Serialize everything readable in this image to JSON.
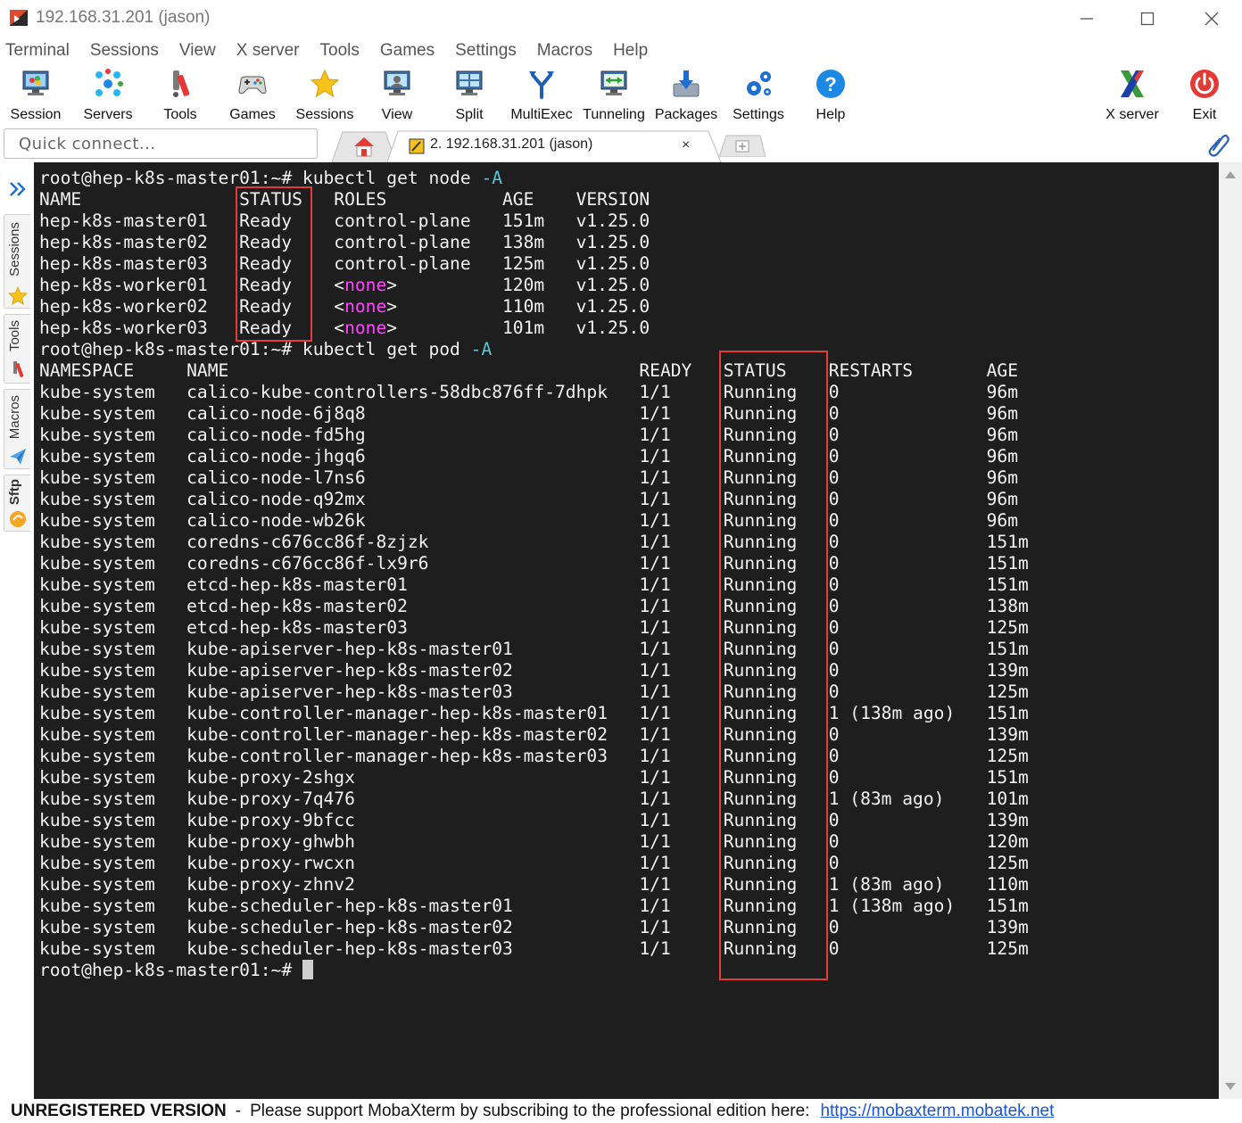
{
  "window": {
    "title": "192.168.31.201 (jason)"
  },
  "menu": [
    "Terminal",
    "Sessions",
    "View",
    "X server",
    "Tools",
    "Games",
    "Settings",
    "Macros",
    "Help"
  ],
  "toolbar": {
    "session": "Session",
    "servers": "Servers",
    "tools": "Tools",
    "games": "Games",
    "sessions": "Sessions",
    "view": "View",
    "split": "Split",
    "multiexec": "MultiExec",
    "tunneling": "Tunneling",
    "packages": "Packages",
    "settings": "Settings",
    "help": "Help",
    "xserver": "X server",
    "exit": "Exit"
  },
  "quick_connect": {
    "placeholder": "Quick connect..."
  },
  "tabs": {
    "active_label": "2. 192.168.31.201 (jason)",
    "close_glyph": "×"
  },
  "side_tabs": {
    "sessions": "Sessions",
    "tools": "Tools",
    "macros": "Macros",
    "sftp": "Sftp"
  },
  "terminal": {
    "prompt": "root@hep-k8s-master01:~# ",
    "node_cmd": "kubectl get node",
    "flag": "-A",
    "pod_cmd": "kubectl get pod",
    "node_header": [
      "NAME",
      "STATUS",
      "ROLES",
      "AGE",
      "VERSION"
    ],
    "nodes": [
      {
        "name": "hep-k8s-master01",
        "status": "Ready",
        "roles": "control-plane",
        "age": "151m",
        "version": "v1.25.0"
      },
      {
        "name": "hep-k8s-master02",
        "status": "Ready",
        "roles": "control-plane",
        "age": "138m",
        "version": "v1.25.0"
      },
      {
        "name": "hep-k8s-master03",
        "status": "Ready",
        "roles": "control-plane",
        "age": "125m",
        "version": "v1.25.0"
      },
      {
        "name": "hep-k8s-worker01",
        "status": "Ready",
        "roles": "<none>",
        "age": "120m",
        "version": "v1.25.0"
      },
      {
        "name": "hep-k8s-worker02",
        "status": "Ready",
        "roles": "<none>",
        "age": "110m",
        "version": "v1.25.0"
      },
      {
        "name": "hep-k8s-worker03",
        "status": "Ready",
        "roles": "<none>",
        "age": "101m",
        "version": "v1.25.0"
      }
    ],
    "pod_header": [
      "NAMESPACE",
      "NAME",
      "READY",
      "STATUS",
      "RESTARTS",
      "AGE"
    ],
    "pods": [
      {
        "ns": "kube-system",
        "name": "calico-kube-controllers-58dbc876ff-7dhpk",
        "ready": "1/1",
        "status": "Running",
        "restarts": "0",
        "age": "96m"
      },
      {
        "ns": "kube-system",
        "name": "calico-node-6j8q8",
        "ready": "1/1",
        "status": "Running",
        "restarts": "0",
        "age": "96m"
      },
      {
        "ns": "kube-system",
        "name": "calico-node-fd5hg",
        "ready": "1/1",
        "status": "Running",
        "restarts": "0",
        "age": "96m"
      },
      {
        "ns": "kube-system",
        "name": "calico-node-jhgq6",
        "ready": "1/1",
        "status": "Running",
        "restarts": "0",
        "age": "96m"
      },
      {
        "ns": "kube-system",
        "name": "calico-node-l7ns6",
        "ready": "1/1",
        "status": "Running",
        "restarts": "0",
        "age": "96m"
      },
      {
        "ns": "kube-system",
        "name": "calico-node-q92mx",
        "ready": "1/1",
        "status": "Running",
        "restarts": "0",
        "age": "96m"
      },
      {
        "ns": "kube-system",
        "name": "calico-node-wb26k",
        "ready": "1/1",
        "status": "Running",
        "restarts": "0",
        "age": "96m"
      },
      {
        "ns": "kube-system",
        "name": "coredns-c676cc86f-8zjzk",
        "ready": "1/1",
        "status": "Running",
        "restarts": "0",
        "age": "151m"
      },
      {
        "ns": "kube-system",
        "name": "coredns-c676cc86f-lx9r6",
        "ready": "1/1",
        "status": "Running",
        "restarts": "0",
        "age": "151m"
      },
      {
        "ns": "kube-system",
        "name": "etcd-hep-k8s-master01",
        "ready": "1/1",
        "status": "Running",
        "restarts": "0",
        "age": "151m"
      },
      {
        "ns": "kube-system",
        "name": "etcd-hep-k8s-master02",
        "ready": "1/1",
        "status": "Running",
        "restarts": "0",
        "age": "138m"
      },
      {
        "ns": "kube-system",
        "name": "etcd-hep-k8s-master03",
        "ready": "1/1",
        "status": "Running",
        "restarts": "0",
        "age": "125m"
      },
      {
        "ns": "kube-system",
        "name": "kube-apiserver-hep-k8s-master01",
        "ready": "1/1",
        "status": "Running",
        "restarts": "0",
        "age": "151m"
      },
      {
        "ns": "kube-system",
        "name": "kube-apiserver-hep-k8s-master02",
        "ready": "1/1",
        "status": "Running",
        "restarts": "0",
        "age": "139m"
      },
      {
        "ns": "kube-system",
        "name": "kube-apiserver-hep-k8s-master03",
        "ready": "1/1",
        "status": "Running",
        "restarts": "0",
        "age": "125m"
      },
      {
        "ns": "kube-system",
        "name": "kube-controller-manager-hep-k8s-master01",
        "ready": "1/1",
        "status": "Running",
        "restarts": "1 (138m ago)",
        "age": "151m"
      },
      {
        "ns": "kube-system",
        "name": "kube-controller-manager-hep-k8s-master02",
        "ready": "1/1",
        "status": "Running",
        "restarts": "0",
        "age": "139m"
      },
      {
        "ns": "kube-system",
        "name": "kube-controller-manager-hep-k8s-master03",
        "ready": "1/1",
        "status": "Running",
        "restarts": "0",
        "age": "125m"
      },
      {
        "ns": "kube-system",
        "name": "kube-proxy-2shgx",
        "ready": "1/1",
        "status": "Running",
        "restarts": "0",
        "age": "151m"
      },
      {
        "ns": "kube-system",
        "name": "kube-proxy-7q476",
        "ready": "1/1",
        "status": "Running",
        "restarts": "1 (83m ago)",
        "age": "101m"
      },
      {
        "ns": "kube-system",
        "name": "kube-proxy-9bfcc",
        "ready": "1/1",
        "status": "Running",
        "restarts": "0",
        "age": "139m"
      },
      {
        "ns": "kube-system",
        "name": "kube-proxy-ghwbh",
        "ready": "1/1",
        "status": "Running",
        "restarts": "0",
        "age": "120m"
      },
      {
        "ns": "kube-system",
        "name": "kube-proxy-rwcxn",
        "ready": "1/1",
        "status": "Running",
        "restarts": "0",
        "age": "125m"
      },
      {
        "ns": "kube-system",
        "name": "kube-proxy-zhnv2",
        "ready": "1/1",
        "status": "Running",
        "restarts": "1 (83m ago)",
        "age": "110m"
      },
      {
        "ns": "kube-system",
        "name": "kube-scheduler-hep-k8s-master01",
        "ready": "1/1",
        "status": "Running",
        "restarts": "1 (138m ago)",
        "age": "151m"
      },
      {
        "ns": "kube-system",
        "name": "kube-scheduler-hep-k8s-master02",
        "ready": "1/1",
        "status": "Running",
        "restarts": "0",
        "age": "139m"
      },
      {
        "ns": "kube-system",
        "name": "kube-scheduler-hep-k8s-master03",
        "ready": "1/1",
        "status": "Running",
        "restarts": "0",
        "age": "125m"
      }
    ]
  },
  "statusbar": {
    "unregistered": "UNREGISTERED VERSION",
    "separator": "-",
    "message": "Please support MobaXterm by subscribing to the professional edition here:",
    "link": "https://mobaxterm.mobatek.net"
  },
  "colors": {
    "terminal_bg": "#1e1e1e",
    "terminal_fg": "#f2f2f2",
    "flag_cyan": "#59c7d6",
    "none_magenta": "#ff46ff",
    "highlight_red": "#e63a3a",
    "link_blue": "#1a55d6"
  },
  "icons": {
    "session": "monitor-icon",
    "servers": "servers-icon",
    "tools": "tools-icon",
    "games": "gamepad-icon",
    "sessions": "star-icon",
    "view": "view-icon",
    "split": "split-icon",
    "multiexec": "multiexec-icon",
    "tunneling": "tunneling-icon",
    "packages": "packages-icon",
    "settings": "gears-icon",
    "help": "help-icon",
    "xserver": "x-server-icon",
    "exit": "power-icon"
  }
}
